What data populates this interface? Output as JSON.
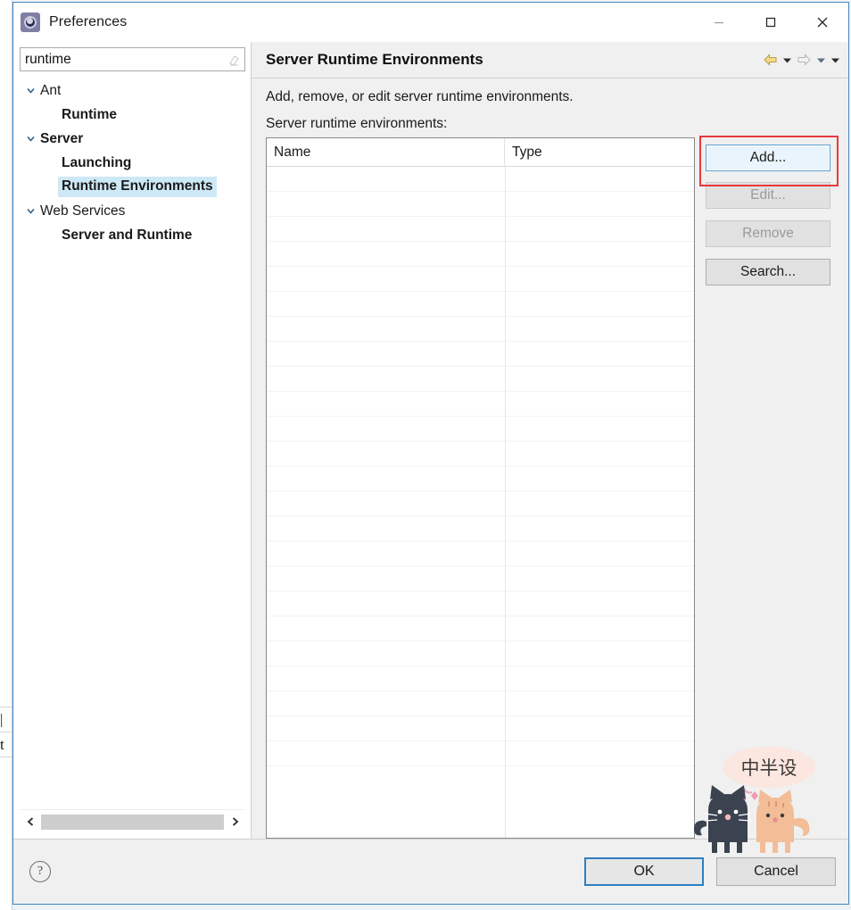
{
  "window": {
    "title": "Preferences",
    "icon": "preferences-gear-icon",
    "controls": {
      "minimize": "minimize-icon",
      "maximize": "maximize-icon",
      "close": "close-icon"
    }
  },
  "filter": {
    "value": "runtime",
    "placeholder": "type filter text",
    "clear_icon": "clear-filter-icon"
  },
  "tree": {
    "items": [
      {
        "label": "Ant",
        "level": 0,
        "expanded": true,
        "selected": false
      },
      {
        "label": "Runtime",
        "level": 1,
        "expanded": false,
        "selected": false
      },
      {
        "label": "Server",
        "level": 0,
        "expanded": true,
        "selected": false
      },
      {
        "label": "Launching",
        "level": 1,
        "expanded": false,
        "selected": false
      },
      {
        "label": "Runtime Environments",
        "level": 1,
        "expanded": false,
        "selected": true
      },
      {
        "label": "Web Services",
        "level": 0,
        "expanded": true,
        "selected": false
      },
      {
        "label": "Server and Runtime",
        "level": 1,
        "expanded": false,
        "selected": false
      }
    ],
    "scrollbar": {
      "left_arrow": "chevron-left-icon",
      "right_arrow": "chevron-right-icon"
    }
  },
  "page": {
    "title": "Server Runtime Environments",
    "description": "Add, remove, or edit server runtime environments.",
    "table_label": "Server runtime environments:",
    "nav": {
      "back": "back-arrow-icon",
      "back_menu": "chevron-down-icon",
      "forward": "forward-arrow-icon",
      "forward_menu": "chevron-down-icon",
      "view_menu": "chevron-down-icon"
    }
  },
  "table": {
    "columns": [
      "Name",
      "Type"
    ],
    "rows": [],
    "empty_row_count": 24
  },
  "side_buttons": [
    {
      "label": "Add...",
      "state": "focused",
      "highlighted": true
    },
    {
      "label": "Edit...",
      "state": "disabled",
      "highlighted": false
    },
    {
      "label": "Remove",
      "state": "disabled",
      "highlighted": false
    },
    {
      "label": "Search...",
      "state": "enabled",
      "highlighted": false
    }
  ],
  "footer": {
    "help_icon": "help-question-icon",
    "ok_label": "OK",
    "cancel_label": "Cancel"
  },
  "background": {
    "clipped_line_1": "|",
    "clipped_line_2": "t"
  },
  "decoration": {
    "name": "cat-watermark",
    "bubble_text": "中半设"
  },
  "colors": {
    "accent": "#2f7fc1",
    "highlight_red": "#e8393c",
    "selection_blue": "#cde8f6",
    "focus_blue": "#5a9fd4"
  }
}
